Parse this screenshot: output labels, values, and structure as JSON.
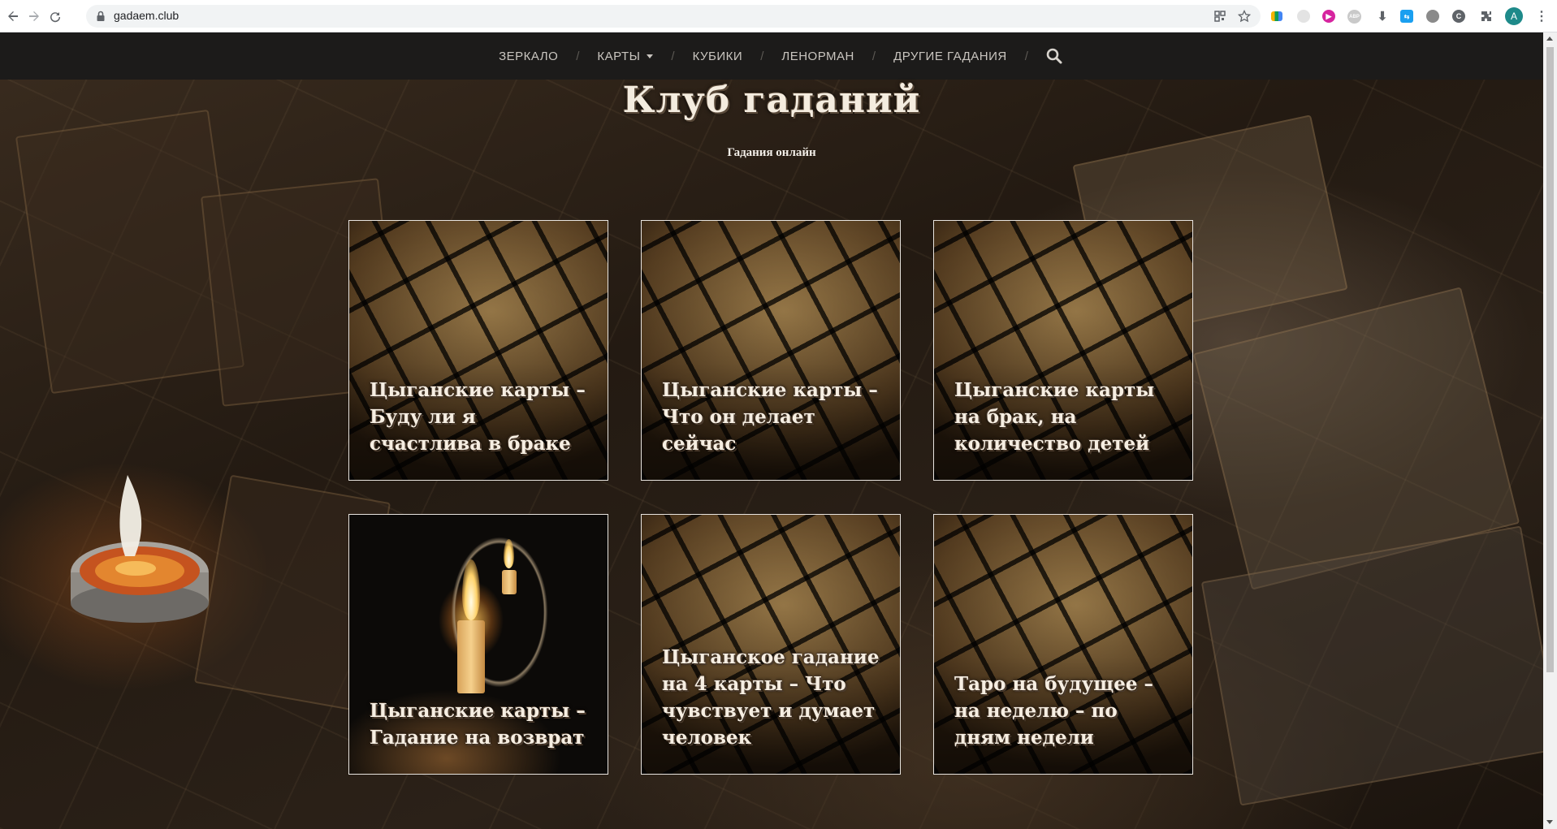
{
  "browser": {
    "url": "gadaem.club",
    "avatar_letter": "A"
  },
  "nav": {
    "items": [
      {
        "label": "ЗЕРКАЛО"
      },
      {
        "label": "КАРТЫ"
      },
      {
        "label": "КУБИКИ"
      },
      {
        "label": "ЛЕНОРМАН"
      },
      {
        "label": "ДРУГИЕ ГАДАНИЯ"
      }
    ],
    "separator": "/"
  },
  "site": {
    "title": "Клуб гаданий",
    "tagline": "Гадания онлайн"
  },
  "tiles": [
    {
      "caption": "Цыганские карты – Буду ли я счастлива в браке",
      "image": "tarot-cards"
    },
    {
      "caption": "Цыганские карты – Что он делает сейчас",
      "image": "tarot-cards"
    },
    {
      "caption": "Цыганские карты на брак, на количество детей",
      "image": "tarot-cards"
    },
    {
      "caption": "Цыганские карты – Гадание на возврат",
      "image": "mirror-candles"
    },
    {
      "caption": "Цыганское гадание на 4 карты – Что чувствует и думает человек",
      "image": "tarot-cards"
    },
    {
      "caption": "Таро на будущее – на неделю – по дням недели",
      "image": "tarot-cards"
    }
  ],
  "colors": {
    "nav_bg": "#1c1b1a",
    "nav_text": "#c9c5bf",
    "tile_border": "#e8e4df"
  },
  "icons": [
    "back-icon",
    "forward-icon",
    "reload-icon",
    "lock-icon",
    "qr-icon",
    "star-icon",
    "extensions-icon",
    "menu-icon",
    "search-icon",
    "caret-down-icon"
  ]
}
